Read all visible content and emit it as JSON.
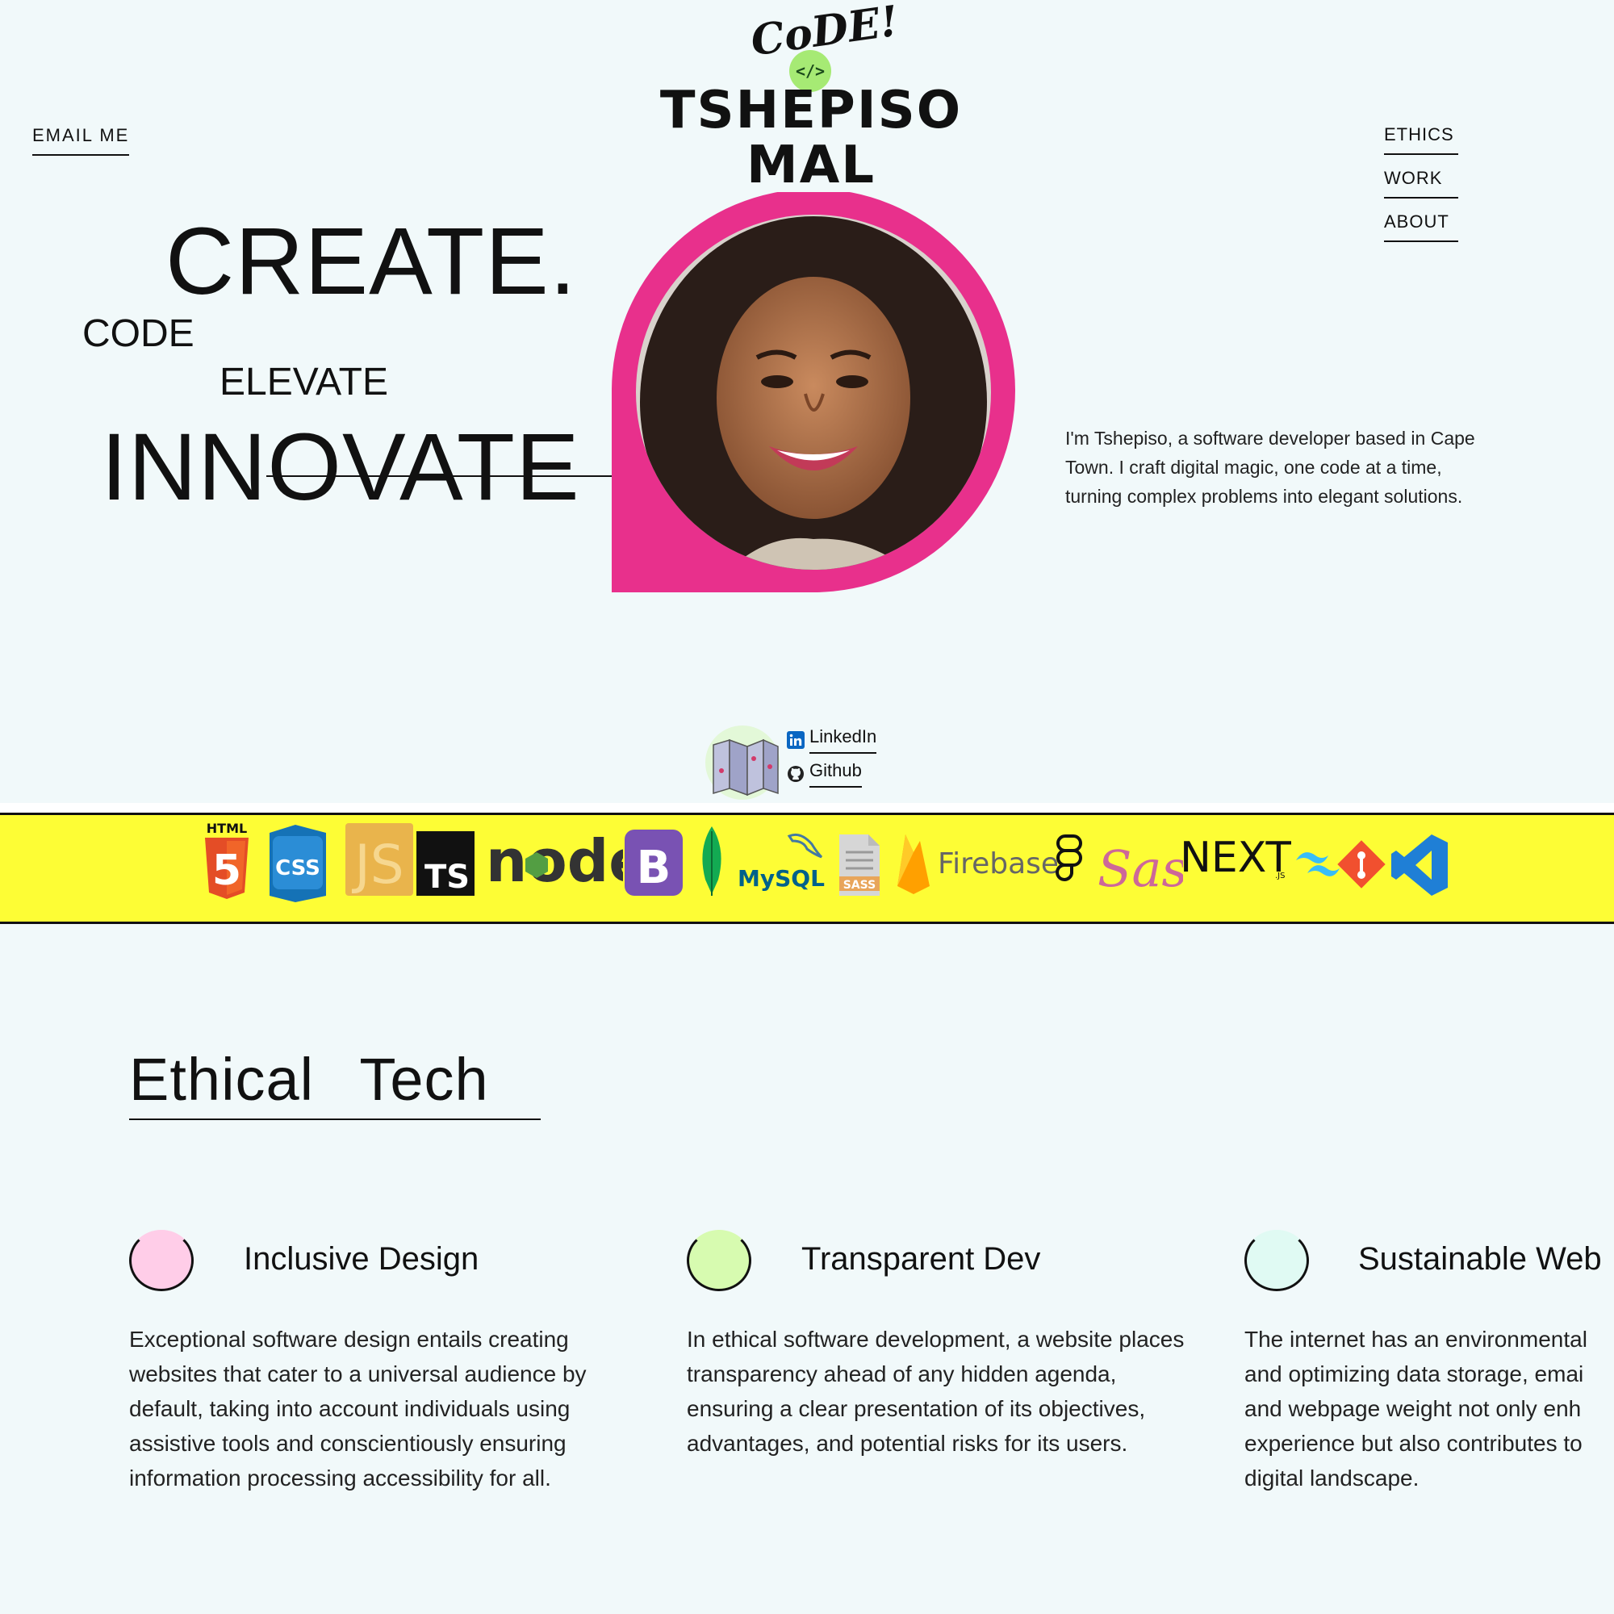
{
  "header": {
    "email_label": "EMAIL ME",
    "nav": [
      "ETHICS",
      "WORK",
      "ABOUT"
    ]
  },
  "logo": {
    "script_text": "CoDE!",
    "badge_text": "</>",
    "name_line1": "TSHEPISO",
    "name_line2": "MAL"
  },
  "hero": {
    "word_create": "CREATE.",
    "word_code": "CODE",
    "word_elevate": "ELEVATE",
    "word_innovate": "INNOVATE",
    "intro": "I'm Tshepiso, a software developer based in Cape Town. I craft digital magic, one code at a time, turning complex problems into elegant solutions.",
    "accent_color": "#e8308c"
  },
  "socials": {
    "linkedin": "LinkedIn",
    "github": "Github"
  },
  "tech_band": {
    "color": "#fdfd35",
    "logos": [
      "html5-icon",
      "css-icon",
      "js-icon",
      "ts-icon",
      "node-icon",
      "bootstrap-icon",
      "mongodb-icon",
      "mysql-icon",
      "sass-file-icon",
      "firebase-icon",
      "figma-icon",
      "sass-icon",
      "nextjs-icon",
      "tailwind-icon",
      "git-icon",
      "vscode-icon"
    ],
    "labels": {
      "html": "HTML",
      "html_num": "5",
      "css": "CSS",
      "js": "JS",
      "ts": "TS",
      "node": "node",
      "bootstrap": "B",
      "mysql": "MySQL",
      "sass_file": "SASS",
      "firebase": "Firebase",
      "sass": "Sass",
      "next": "NEXT",
      "next_sub": ".JS"
    }
  },
  "ethics": {
    "title": "Ethical Tech",
    "cards": [
      {
        "title": "Inclusive Design",
        "color": "#ffcde8",
        "text": "Exceptional software design entails creating websites that cater to a universal audience by default, taking into account individuals using assistive tools and conscientiously ensuring information processing accessibility for all."
      },
      {
        "title": "Transparent Dev",
        "color": "#d7fbb0",
        "text": "In ethical software development, a website places transparency ahead of any hidden agenda, ensuring a clear presentation of its objectives, advantages, and potential risks for its users."
      },
      {
        "title": "Sustainable Web",
        "color": "#e0faf3",
        "text": "The internet has an environmental and optimizing data storage, emai and webpage weight not only enh experience but also contributes to digital landscape."
      }
    ]
  }
}
